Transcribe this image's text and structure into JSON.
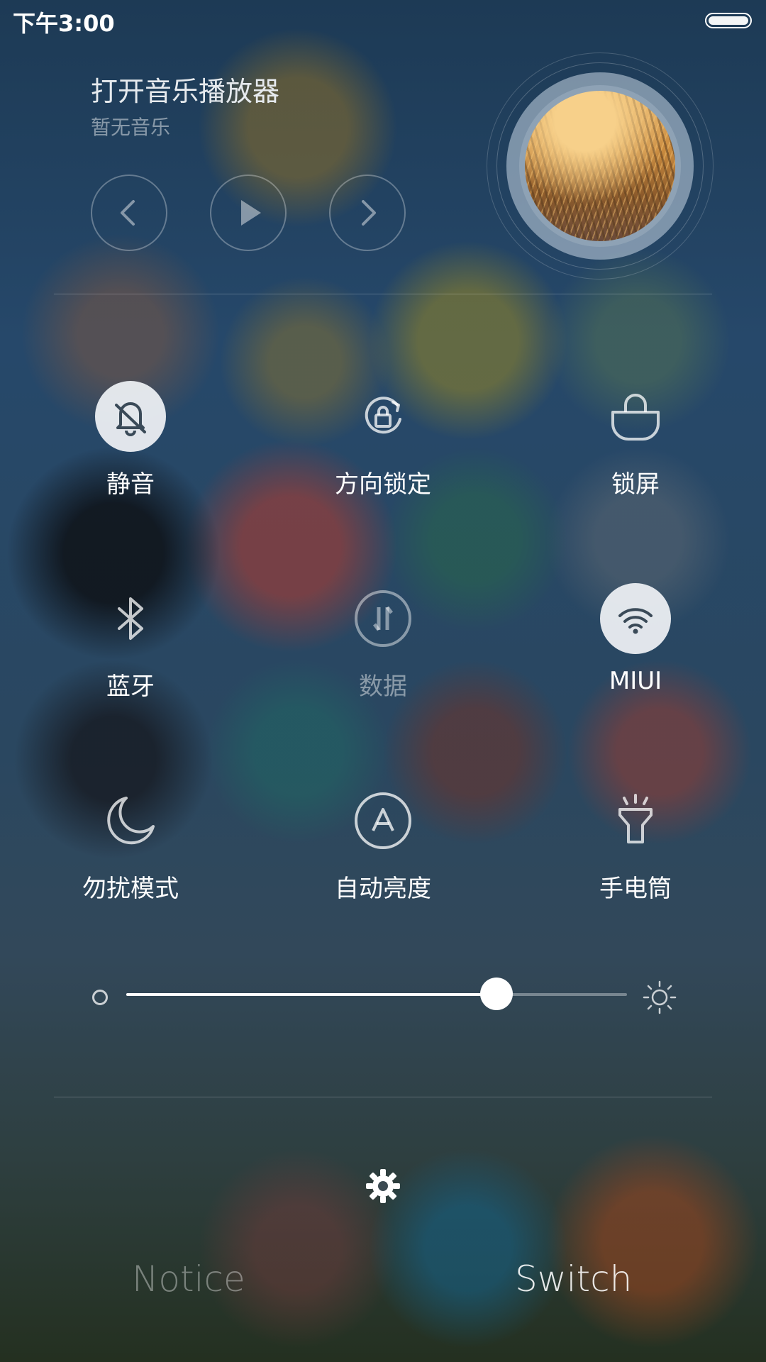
{
  "status_bar": {
    "time": "下午3:00"
  },
  "music_player": {
    "title": "打开音乐播放器",
    "subtitle": "暂无音乐",
    "controls": [
      {
        "name": "previous",
        "icon": "chevron-left-icon"
      },
      {
        "name": "play",
        "icon": "play-icon"
      },
      {
        "name": "next",
        "icon": "chevron-right-icon"
      }
    ]
  },
  "toggles": [
    {
      "label": "静音",
      "icon": "bell-off-icon",
      "active": true
    },
    {
      "label": "方向锁定",
      "icon": "rotation-lock-icon",
      "active": false
    },
    {
      "label": "锁屏",
      "icon": "lock-icon",
      "active": false
    },
    {
      "label": "蓝牙",
      "icon": "bluetooth-icon",
      "active": false
    },
    {
      "label": "数据",
      "icon": "mobile-data-icon",
      "active": false,
      "disabled": true
    },
    {
      "label": "MIUI",
      "icon": "wifi-icon",
      "active": true
    },
    {
      "label": "勿扰模式",
      "icon": "moon-icon",
      "active": false
    },
    {
      "label": "自动亮度",
      "icon": "auto-brightness-icon",
      "active": false
    },
    {
      "label": "手电筒",
      "icon": "flashlight-icon",
      "active": false
    }
  ],
  "brightness": {
    "level": 0.74,
    "low_icon": "brightness-low-icon",
    "high_icon": "sun-icon"
  },
  "settings": {
    "icon": "gear-icon"
  },
  "tabs": {
    "notice": "Notice",
    "switch": "Switch",
    "active": "switch"
  }
}
